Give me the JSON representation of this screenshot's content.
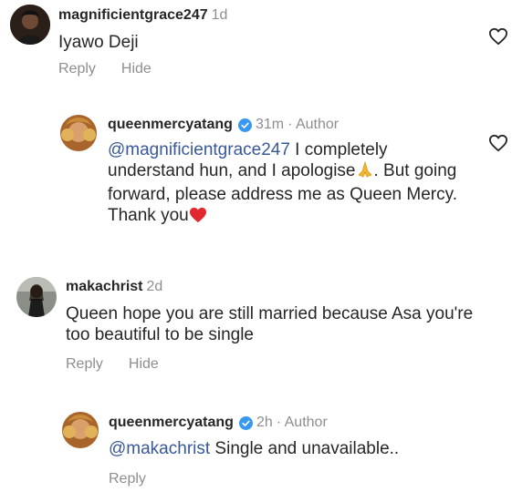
{
  "comments": [
    {
      "username": "magnificientgrace247",
      "time": "1d",
      "text": "Iyawo Deji",
      "actions": [
        "Reply",
        "Hide"
      ]
    },
    {
      "username": "queenmercyatang",
      "time": "31m",
      "author_label": "· Author",
      "mention": "@magnificientgrace247",
      "text_1": " I completely understand hun, and I apologise",
      "text_2": ". But going forward, please address me as Queen Mercy. Thank you"
    },
    {
      "username": "makachrist",
      "time": "2d",
      "text": "Queen hope you are still married because Asa you're too beautiful to be single",
      "actions": [
        "Reply",
        "Hide"
      ]
    },
    {
      "username": "queenmercyatang",
      "time": "2h",
      "author_label": "· Author",
      "mention": "@makachrist",
      "text": " Single and unavailable..",
      "actions": [
        "Reply"
      ]
    }
  ],
  "colors": {
    "text": "#262626",
    "muted": "#8e8e8e",
    "mention": "#385898",
    "verified": "#3897f0"
  }
}
